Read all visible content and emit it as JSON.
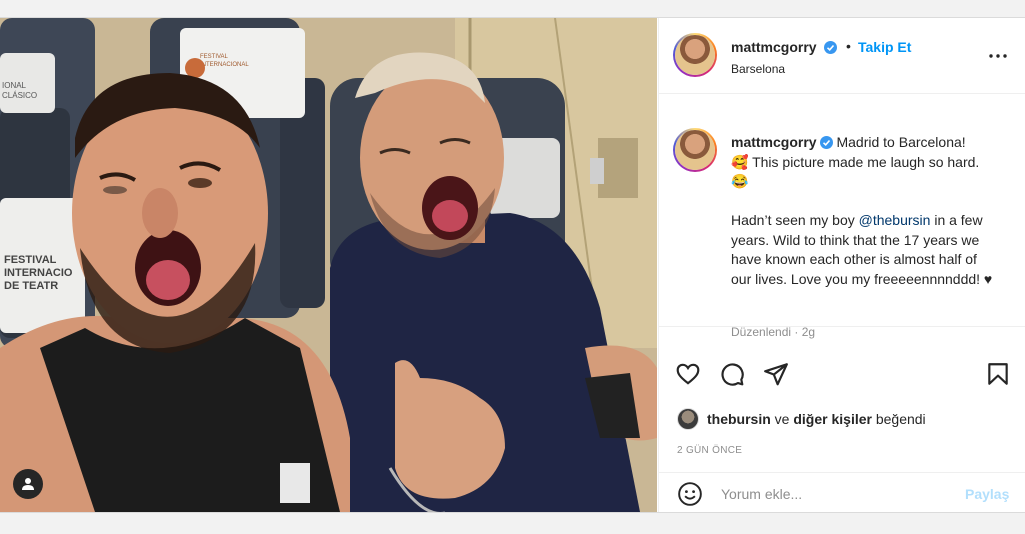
{
  "post": {
    "username": "mattmcgorry",
    "separator": "•",
    "follow_label": "Takip Et",
    "location": "Barselona",
    "caption_first": "Madrid to Barcelona!",
    "caption_line2": "🥰 This picture made me laugh so hard. 😂",
    "caption_p2_before": "Hadn’t seen my boy ",
    "caption_mention": "@thebursin",
    "caption_p2_after": " in a few years. Wild to think that the 17 years we have known each other is almost half of our lives. Love you my freeeeennnnddd! ♥",
    "edited_meta": "Düzenlendi · 2g",
    "likes_user": "thebursin",
    "likes_mid": " ve ",
    "likes_others": "diğer kişiler",
    "likes_end": " beğendi",
    "time_ago": "2 GÜN ÖNCE"
  },
  "comment": {
    "placeholder": "Yorum ekle...",
    "share_label": "Paylaş"
  },
  "photo_signs": {
    "sign_top": "FESTIVAL INTERNACIONAL DE TEATRO CLÁSICO",
    "sign_left_1": "FESTIVAL",
    "sign_left_2": "INTERNACIO",
    "sign_left_3": "DE TEATR",
    "sign_topleft": "IONAL CLÁSICO"
  },
  "colors": {
    "accent": "#0095f6",
    "verified": "#3897f0",
    "share_disabled": "#b2dffc"
  },
  "icons": {
    "more": "more-options-icon",
    "like": "heart-icon",
    "comment": "comment-icon",
    "share": "send-icon",
    "save": "bookmark-icon",
    "emoji": "emoji-icon",
    "user_tag": "user-tag-icon",
    "verified": "verified-badge-icon"
  }
}
